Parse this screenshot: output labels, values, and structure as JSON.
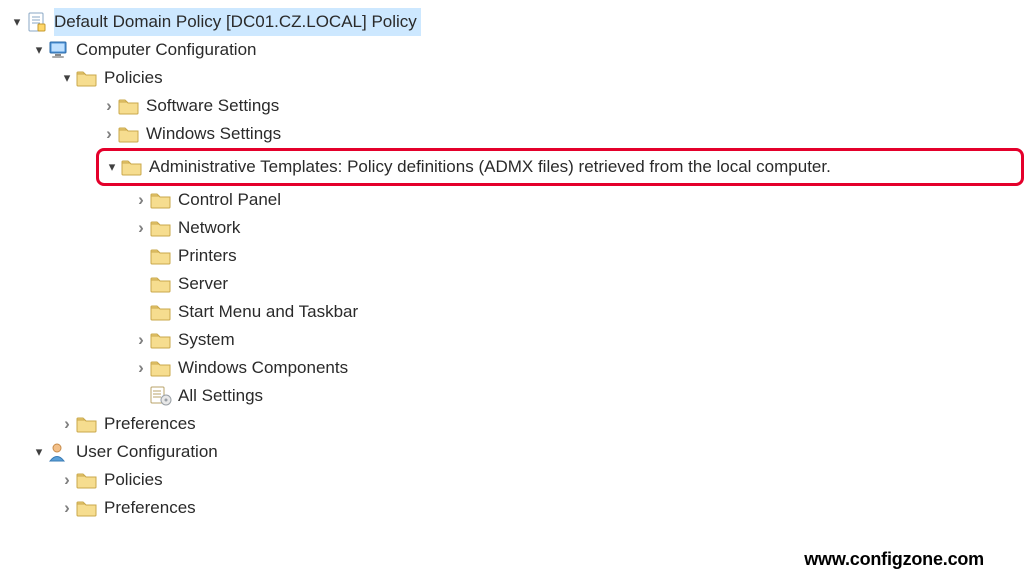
{
  "root": {
    "label": "Default Domain Policy [DC01.CZ.LOCAL] Policy"
  },
  "computer_cfg": {
    "label": "Computer Configuration"
  },
  "policies1": {
    "label": "Policies"
  },
  "software_settings": {
    "label": "Software Settings"
  },
  "windows_settings": {
    "label": "Windows Settings"
  },
  "admin_templates": {
    "label": "Administrative Templates: Policy definitions (ADMX files) retrieved from the local computer."
  },
  "control_panel": {
    "label": "Control Panel"
  },
  "network": {
    "label": "Network"
  },
  "printers": {
    "label": "Printers"
  },
  "server": {
    "label": "Server"
  },
  "start_menu": {
    "label": "Start Menu and Taskbar"
  },
  "system": {
    "label": "System"
  },
  "win_components": {
    "label": "Windows Components"
  },
  "all_settings": {
    "label": "All Settings"
  },
  "preferences1": {
    "label": "Preferences"
  },
  "user_cfg": {
    "label": "User Configuration"
  },
  "policies2": {
    "label": "Policies"
  },
  "preferences2": {
    "label": "Preferences"
  },
  "watermark": "www.configzone.com"
}
